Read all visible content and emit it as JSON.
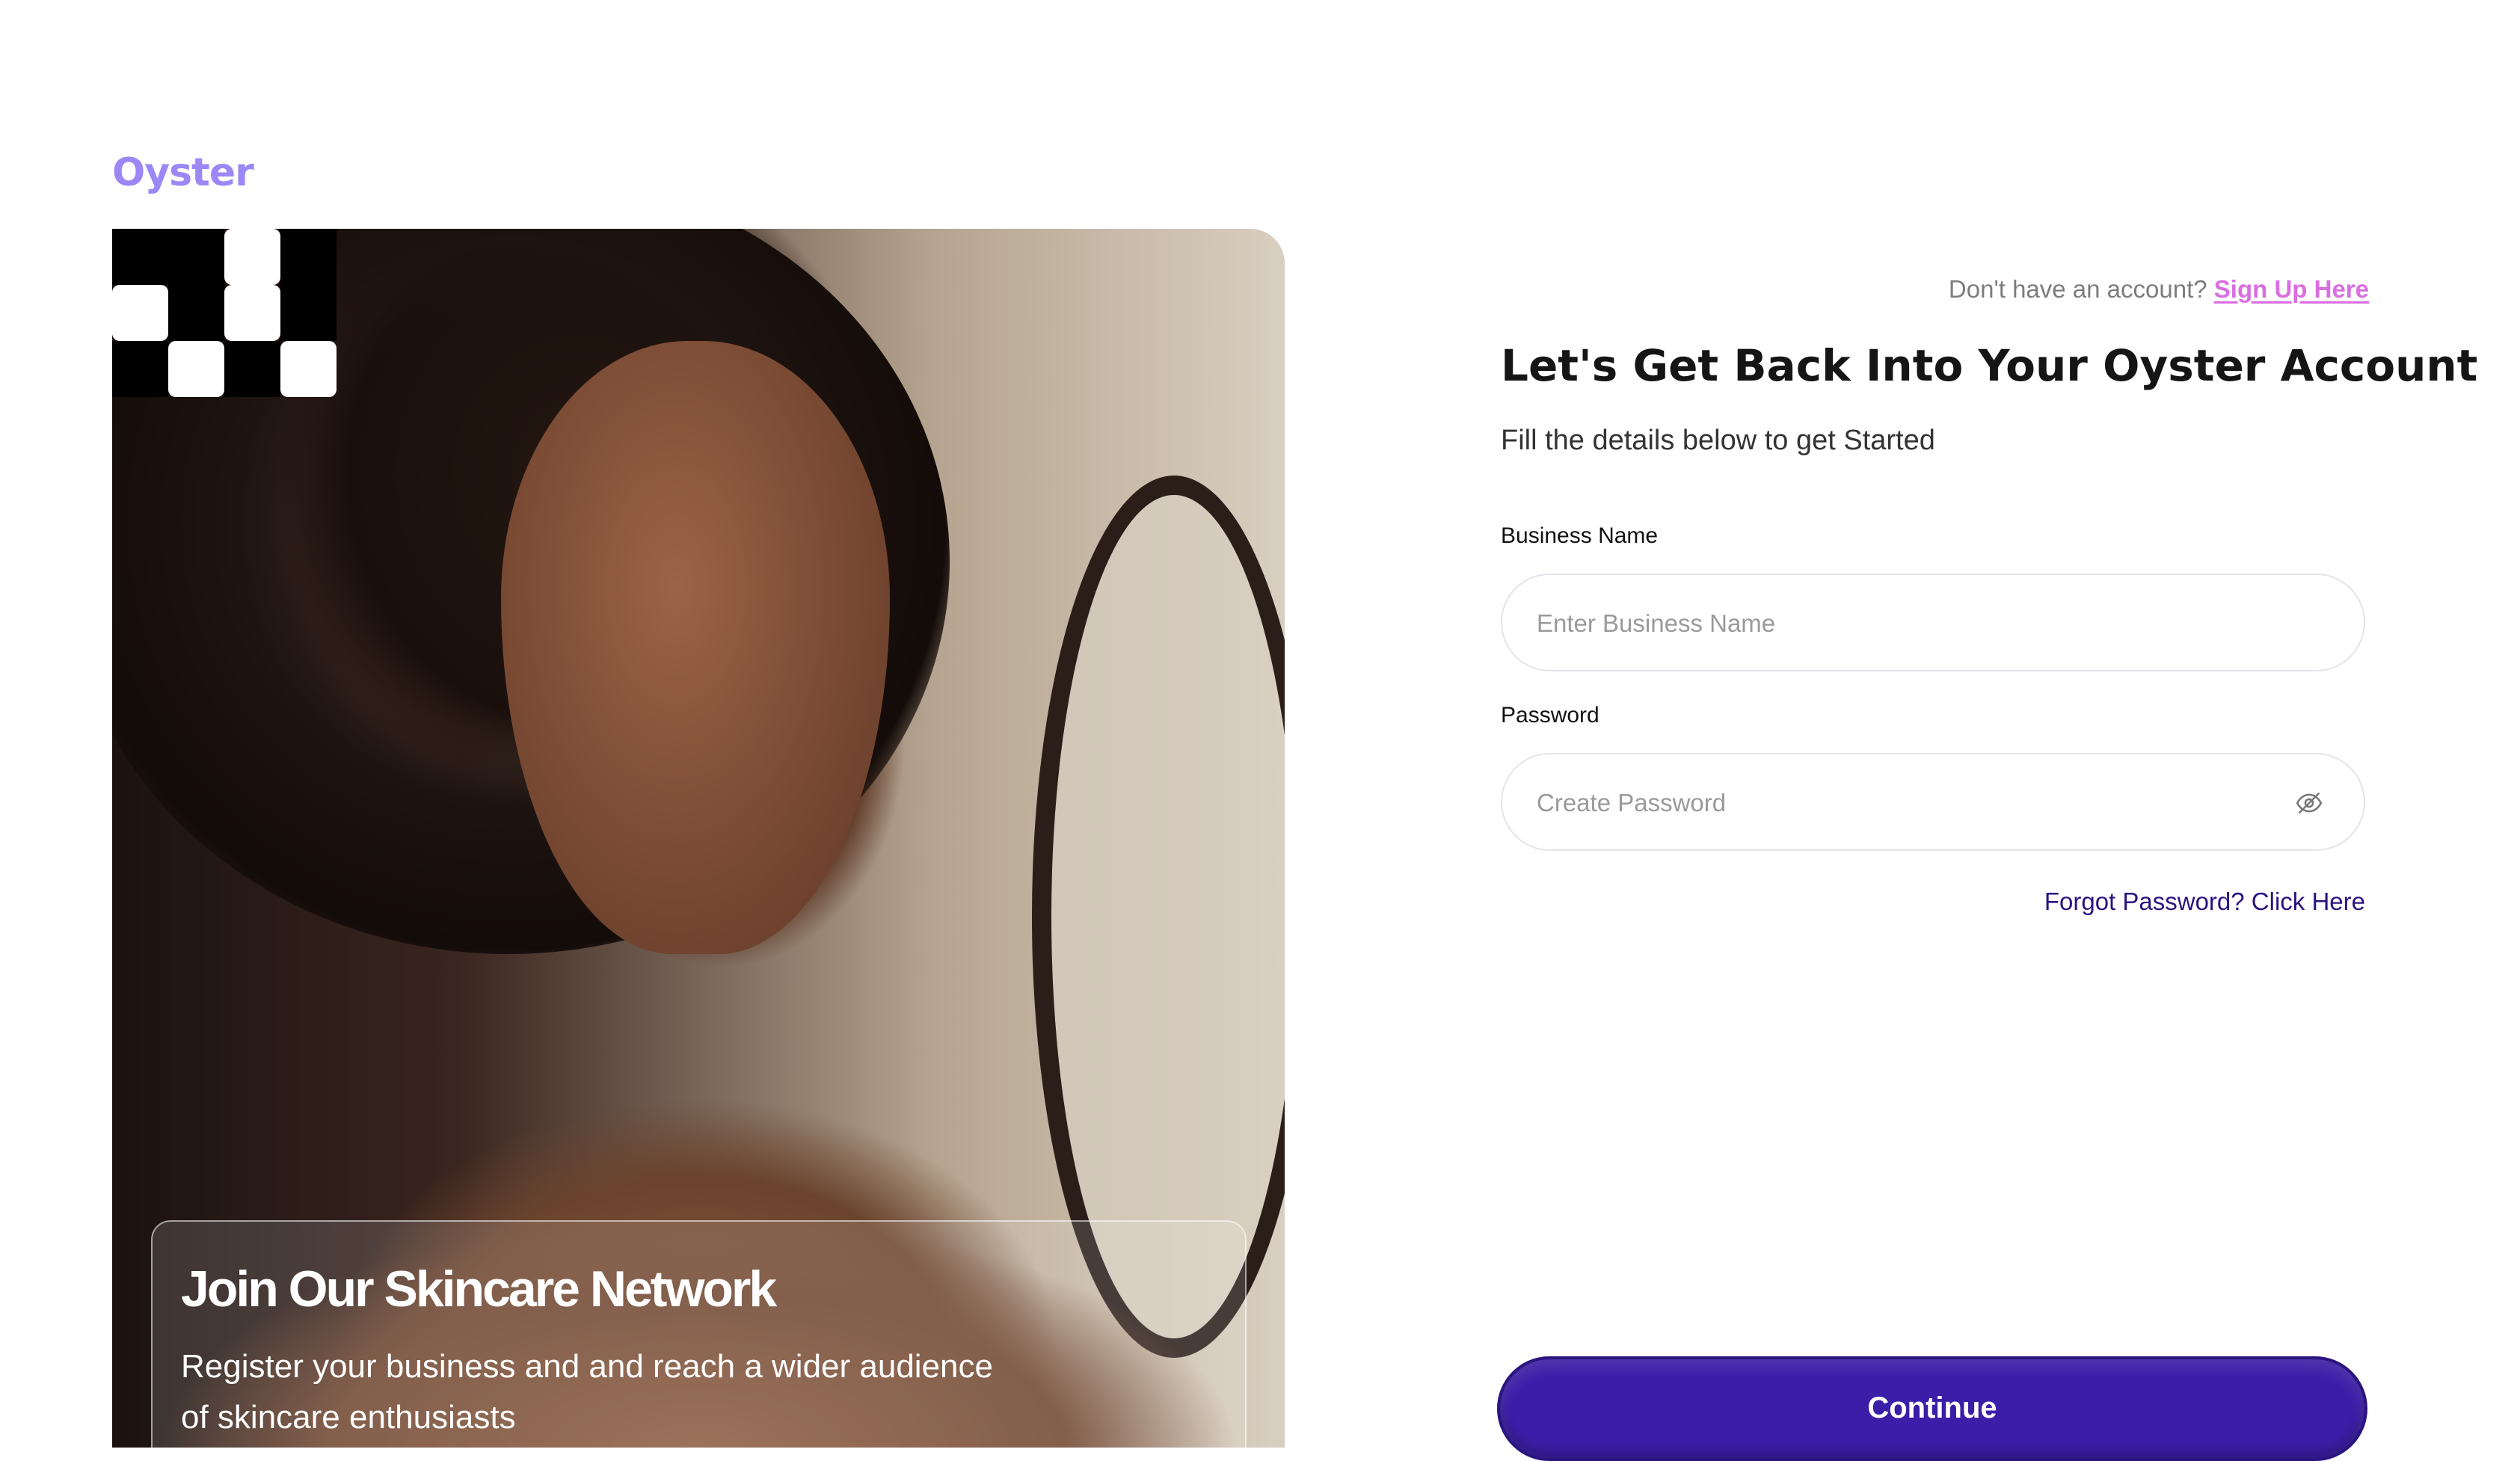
{
  "brand": {
    "logo_text": "Oyster",
    "logo_color": "#9b87f5"
  },
  "hero": {
    "title": "Join Our Skincare Network",
    "description": "Register your business and and reach a wider audience of skincare enthusiasts"
  },
  "signup": {
    "prompt": "Don't have an account?",
    "link_label": "Sign Up Here",
    "link_color": "#d96ee0"
  },
  "form": {
    "title": "Let's Get Back Into Your Oyster Account",
    "subtitle": "Fill the details below to get Started",
    "business_name": {
      "label": "Business Name",
      "placeholder": "Enter Business Name",
      "value": ""
    },
    "password": {
      "label": "Password",
      "placeholder": "Create Password",
      "value": ""
    },
    "forgot_label": "Forgot Password? Click Here",
    "forgot_color": "#2a1480",
    "submit_label": "Continue",
    "submit_color": "#3b1ea8"
  },
  "icons": {
    "password_toggle": "eye-off-icon"
  }
}
